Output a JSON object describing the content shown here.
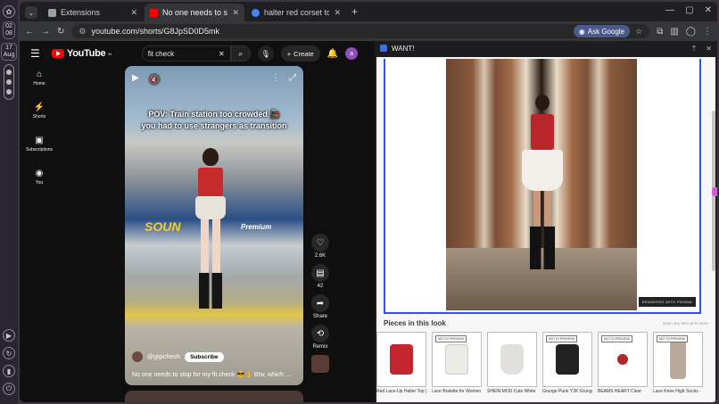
{
  "os_rail": {
    "clock_lines": [
      "02",
      "08"
    ],
    "date_lines": [
      "17",
      "Aug"
    ]
  },
  "tabs": [
    {
      "label": "Extensions",
      "active": false,
      "icon": "puzzle-icon",
      "color": "#9aa0a6"
    },
    {
      "label": "No one needs to stop fo",
      "active": true,
      "icon": "youtube-icon",
      "color": "#ff0000"
    },
    {
      "label": "halter red corset top - G",
      "active": false,
      "icon": "google-icon",
      "color": "#4285f4"
    }
  ],
  "toolbar": {
    "url": "youtube.com/shorts/G8JpSD0D5mk",
    "ask_google": "Ask Google"
  },
  "youtube": {
    "logo_text": "YouTube",
    "logo_region": "IN",
    "search_value": "fit check",
    "create_label": "Create",
    "avatar_letter": "a",
    "nav": [
      {
        "label": "Home",
        "icon": "home-icon"
      },
      {
        "label": "Shorts",
        "icon": "shorts-icon"
      },
      {
        "label": "Subscriptions",
        "icon": "subscriptions-icon"
      },
      {
        "label": "You",
        "icon": "you-icon"
      }
    ],
    "video": {
      "caption_line1": "POV: Train station too crowded 🚂",
      "caption_line2": "you had to use strangers as transition",
      "train_logo": "SOU",
      "train_logo_2": "N",
      "train_sub": "Premium",
      "channel": "@gigicheoh",
      "subscribe_label": "Subscribe",
      "title": "No one needs to stop for my fit check 😎👌 Btw, which ..."
    },
    "actions": [
      {
        "icon": "like-icon",
        "label": "2.6K"
      },
      {
        "icon": "comment-icon",
        "label": "42"
      },
      {
        "icon": "share-icon",
        "label": "Share"
      },
      {
        "icon": "remix-icon",
        "label": "Remix"
      }
    ]
  },
  "panel": {
    "title": "WANT!",
    "badge": "RENDERED WITH PRISMA",
    "pieces_title": "Pieces in this look",
    "pieces_subtitle": "Open any item at its store",
    "items": [
      {
        "label": "Red Lace-Up Halter Top |",
        "not_in_preview": false,
        "color": "#c42630"
      },
      {
        "label": "Lace Bralette for Women",
        "not_in_preview": true,
        "color": "#ecebe6"
      },
      {
        "label": "SHEIN MOD Cute White",
        "not_in_preview": false,
        "color": "#e2e0dc"
      },
      {
        "label": "Grunge Punk Y2K Grunge",
        "not_in_preview": true,
        "color": "#222222"
      },
      {
        "label": "BEAMS HEART Clear",
        "not_in_preview": true,
        "color": "#b0262a"
      },
      {
        "label": "Lace Knee High Socks -",
        "not_in_preview": true,
        "color": "#b9a99a"
      }
    ],
    "not_in_preview_label": "NOT IN PREVIEW"
  }
}
